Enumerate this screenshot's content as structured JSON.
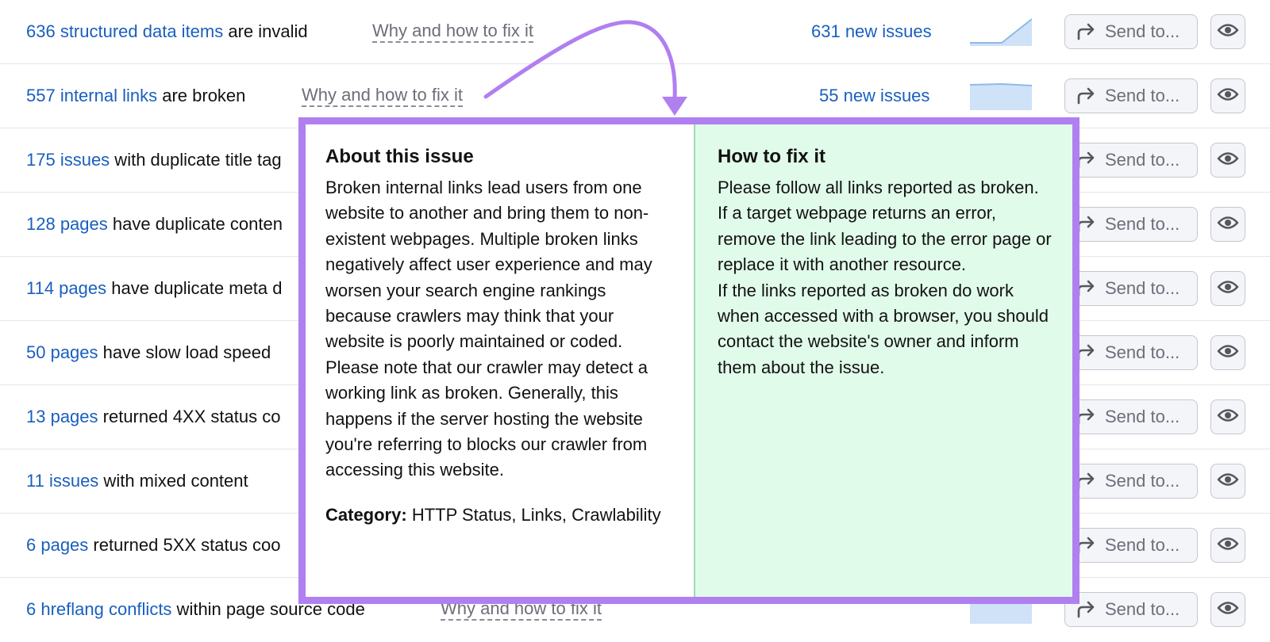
{
  "colors": {
    "link": "#1a5fbf",
    "muted": "#6c6e79",
    "accent_purple": "#b07ff0",
    "fix_panel_bg": "#e1fbea",
    "sparkline_fill": "#cfe2f7",
    "sparkline_line": "#8fbaea"
  },
  "issues": [
    {
      "link_text": "636 structured data items",
      "rest_text": " are invalid",
      "why_label": "Why and how to fix it",
      "new_issues": "631 new issues",
      "send_label": "Send to..."
    },
    {
      "link_text": "557 internal links",
      "rest_text": " are broken",
      "why_label": "Why and how to fix it",
      "new_issues": "55 new issues",
      "send_label": "Send to..."
    },
    {
      "link_text": "175 issues",
      "rest_text": " with duplicate title tag",
      "send_label": "Send to..."
    },
    {
      "link_text": "128 pages",
      "rest_text": " have duplicate conten",
      "send_label": "Send to..."
    },
    {
      "link_text": "114 pages",
      "rest_text": " have duplicate meta d",
      "send_label": "Send to..."
    },
    {
      "link_text": "50 pages",
      "rest_text": " have slow load speed",
      "send_label": "Send to..."
    },
    {
      "link_text": "13 pages",
      "rest_text": " returned 4XX status co",
      "send_label": "Send to..."
    },
    {
      "link_text": "11 issues",
      "rest_text": " with mixed content",
      "send_label": "Send to..."
    },
    {
      "link_text": "6 pages",
      "rest_text": " returned 5XX status coo",
      "send_label": "Send to..."
    },
    {
      "link_text": "6 hreflang conflicts",
      "rest_text": " within page source code",
      "why_label": "Why and how to fix it",
      "send_label": "Send to..."
    }
  ],
  "popover": {
    "about_heading": "About this issue",
    "about_para1": "Broken internal links lead users from one website to another and bring them to non-existent webpages. Multiple broken links negatively affect user experience and may worsen your search engine rankings because crawlers may think that your website is poorly maintained or coded.",
    "about_para2": "Please note that our crawler may detect a working link as broken. Generally, this happens if the server hosting the website you're referring to blocks our crawler from accessing this website.",
    "category_label": "Category:",
    "category_value": "HTTP Status, Links, Crawlability",
    "fix_heading": "How to fix it",
    "fix_para1": "Please follow all links reported as broken. If a target webpage returns an error, remove the link leading to the error page or replace it with another resource.",
    "fix_para2": "If the links reported as broken do work when accessed with a browser, you should contact the website's owner and inform them about the issue."
  }
}
